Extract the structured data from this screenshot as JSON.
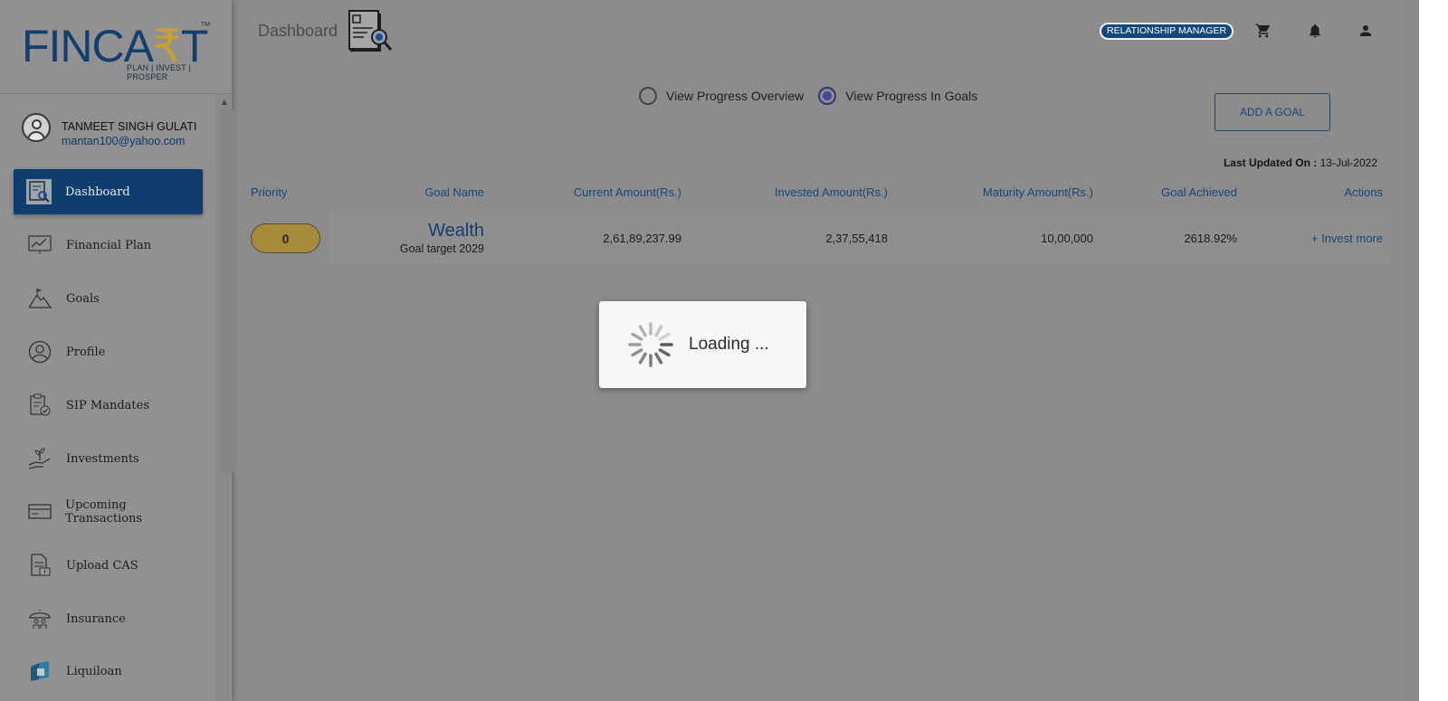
{
  "brand": {
    "logo_text_a": "FINCA",
    "logo_text_r": "₹",
    "logo_text_b": "T",
    "logo_tm": "TM",
    "logo_tagline": "PLAN | INVEST | PROSPER"
  },
  "user": {
    "name": "TANMEET SINGH GULATI",
    "email": "mantan100@yahoo.com"
  },
  "sidebar": {
    "items": [
      {
        "label": "Dashboard",
        "icon": "dashboard-icon",
        "active": true
      },
      {
        "label": "Financial Plan",
        "icon": "chart-icon"
      },
      {
        "label": "Goals",
        "icon": "mountain-flag-icon"
      },
      {
        "label": "Profile",
        "icon": "user-circle-icon"
      },
      {
        "label": "SIP Mandates",
        "icon": "clipboard-check-icon"
      },
      {
        "label": "Investments",
        "icon": "hand-plant-icon"
      },
      {
        "label": "Upcoming Transactions",
        "icon": "card-icon"
      },
      {
        "label": "Upload CAS",
        "icon": "document-upload-icon"
      },
      {
        "label": "Insurance",
        "icon": "umbrella-family-icon"
      },
      {
        "label": "Liquiloan",
        "icon": "liquiloan-logo-icon"
      }
    ]
  },
  "header": {
    "title": "Dashboard",
    "badge": "RELATIONSHIP  MANAGER",
    "icons": [
      "cart-icon",
      "bell-icon",
      "account-icon"
    ]
  },
  "view_options": {
    "overview_label": "View Progress Overview",
    "goals_label": "View Progress In Goals",
    "selected": "goals"
  },
  "add_goal_label": "ADD A GOAL",
  "last_updated": {
    "label": "Last Updated On :",
    "value": "13-Jul-2022"
  },
  "table": {
    "headers": {
      "priority": "Priority",
      "goal_name": "Goal Name",
      "current": "Current Amount(Rs.)",
      "invested": "Invested Amount(Rs.)",
      "maturity": "Maturity Amount(Rs.)",
      "achieved": "Goal Achieved",
      "actions": "Actions"
    },
    "rows": [
      {
        "priority": "0",
        "goal_name": "Wealth",
        "goal_target": "Goal target 2029",
        "current": "2,61,89,237.99",
        "invested": "2,37,55,418",
        "maturity": "10,00,000",
        "achieved": "2618.92%",
        "action": "+ Invest more"
      }
    ]
  },
  "loading": {
    "text": "Loading  ..."
  },
  "colors": {
    "brand_navy": "#0e3d6e",
    "brand_gold": "#c9a030",
    "link_blue": "#17457a",
    "overlay_gray": "#8c8c8c"
  }
}
